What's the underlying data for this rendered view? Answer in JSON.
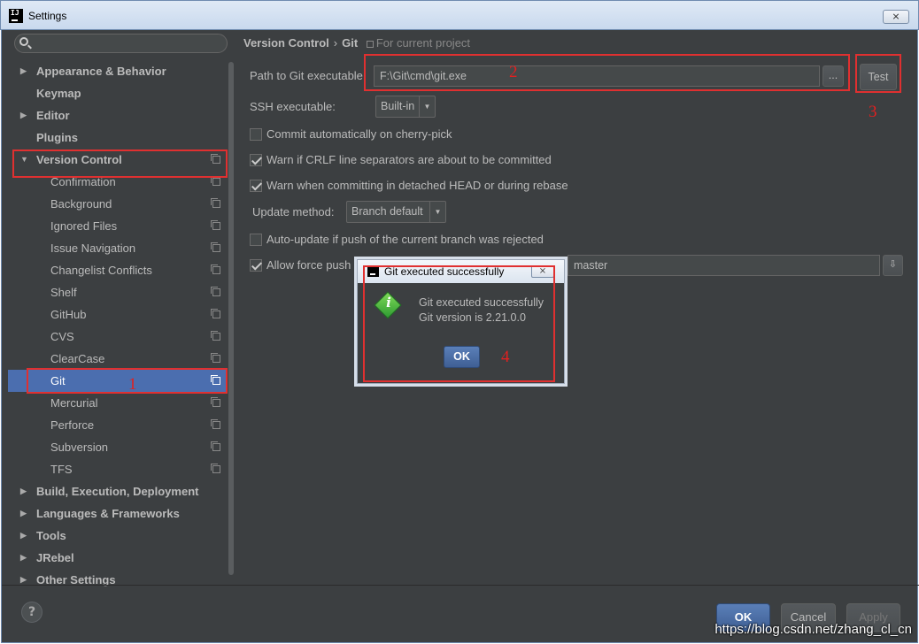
{
  "window": {
    "title": "Settings",
    "close_glyph": "⨯"
  },
  "sidebar": {
    "search_placeholder": "",
    "items": [
      {
        "label": "Appearance & Behavior",
        "level": 0,
        "expandable": true,
        "expanded": false
      },
      {
        "label": "Keymap",
        "level": 0,
        "expandable": false
      },
      {
        "label": "Editor",
        "level": 0,
        "expandable": true,
        "expanded": false
      },
      {
        "label": "Plugins",
        "level": 0,
        "expandable": false
      },
      {
        "label": "Version Control",
        "level": 0,
        "expandable": true,
        "expanded": true,
        "scope_icon": true
      },
      {
        "label": "Confirmation",
        "level": 1,
        "scope_icon": true
      },
      {
        "label": "Background",
        "level": 1,
        "scope_icon": true
      },
      {
        "label": "Ignored Files",
        "level": 1,
        "scope_icon": true
      },
      {
        "label": "Issue Navigation",
        "level": 1,
        "scope_icon": true
      },
      {
        "label": "Changelist Conflicts",
        "level": 1,
        "scope_icon": true
      },
      {
        "label": "Shelf",
        "level": 1,
        "scope_icon": true
      },
      {
        "label": "GitHub",
        "level": 1,
        "scope_icon": true
      },
      {
        "label": "CVS",
        "level": 1,
        "scope_icon": true
      },
      {
        "label": "ClearCase",
        "level": 1,
        "scope_icon": true
      },
      {
        "label": "Git",
        "level": 1,
        "scope_icon": true,
        "selected": true
      },
      {
        "label": "Mercurial",
        "level": 1,
        "scope_icon": true
      },
      {
        "label": "Perforce",
        "level": 1,
        "scope_icon": true
      },
      {
        "label": "Subversion",
        "level": 1,
        "scope_icon": true
      },
      {
        "label": "TFS",
        "level": 1,
        "scope_icon": true
      },
      {
        "label": "Build, Execution, Deployment",
        "level": 0,
        "expandable": true
      },
      {
        "label": "Languages & Frameworks",
        "level": 0,
        "expandable": true
      },
      {
        "label": "Tools",
        "level": 0,
        "expandable": true
      },
      {
        "label": "JRebel",
        "level": 0,
        "expandable": true
      },
      {
        "label": "Other Settings",
        "level": 0,
        "expandable": true
      }
    ]
  },
  "breadcrumb": {
    "parent": "Version Control",
    "separator": "›",
    "current": "Git",
    "scope": "For current project"
  },
  "form": {
    "path_label": "Path to Git executable:",
    "path_value": "F:\\Git\\cmd\\git.exe",
    "browse_label": "...",
    "test_label": "Test",
    "ssh_label": "SSH executable:",
    "ssh_value": "Built-in",
    "cherry_pick_label": "Commit automatically on cherry-pick",
    "cherry_pick_checked": false,
    "crlf_label": "Warn if CRLF line separators are about to be committed",
    "crlf_checked": true,
    "detached_label": "Warn when committing in detached HEAD or during rebase",
    "detached_checked": true,
    "update_method_label": "Update method:",
    "update_method_value": "Branch default",
    "auto_update_label": "Auto-update if push of the current branch was rejected",
    "auto_update_checked": false,
    "force_push_label": "Allow force push",
    "force_push_checked": true,
    "protected_branches_value": "master"
  },
  "dialog": {
    "title": "Git executed successfully",
    "message_line1": "Git executed successfully",
    "message_line2": "Git version is 2.21.0.0",
    "ok_label": "OK"
  },
  "footer": {
    "help_label": "?",
    "ok_label": "OK",
    "cancel_label": "Cancel",
    "apply_label": "Apply"
  },
  "annotations": {
    "n1": "1",
    "n2": "2",
    "n3": "3",
    "n4": "4"
  },
  "watermark": "https://blog.csdn.net/zhang_cl_cn",
  "colors": {
    "panel_bg": "#3c3f41",
    "selection": "#4b6eaf",
    "annotation_red": "#e03030",
    "ok_button": "#4a6ea9"
  }
}
